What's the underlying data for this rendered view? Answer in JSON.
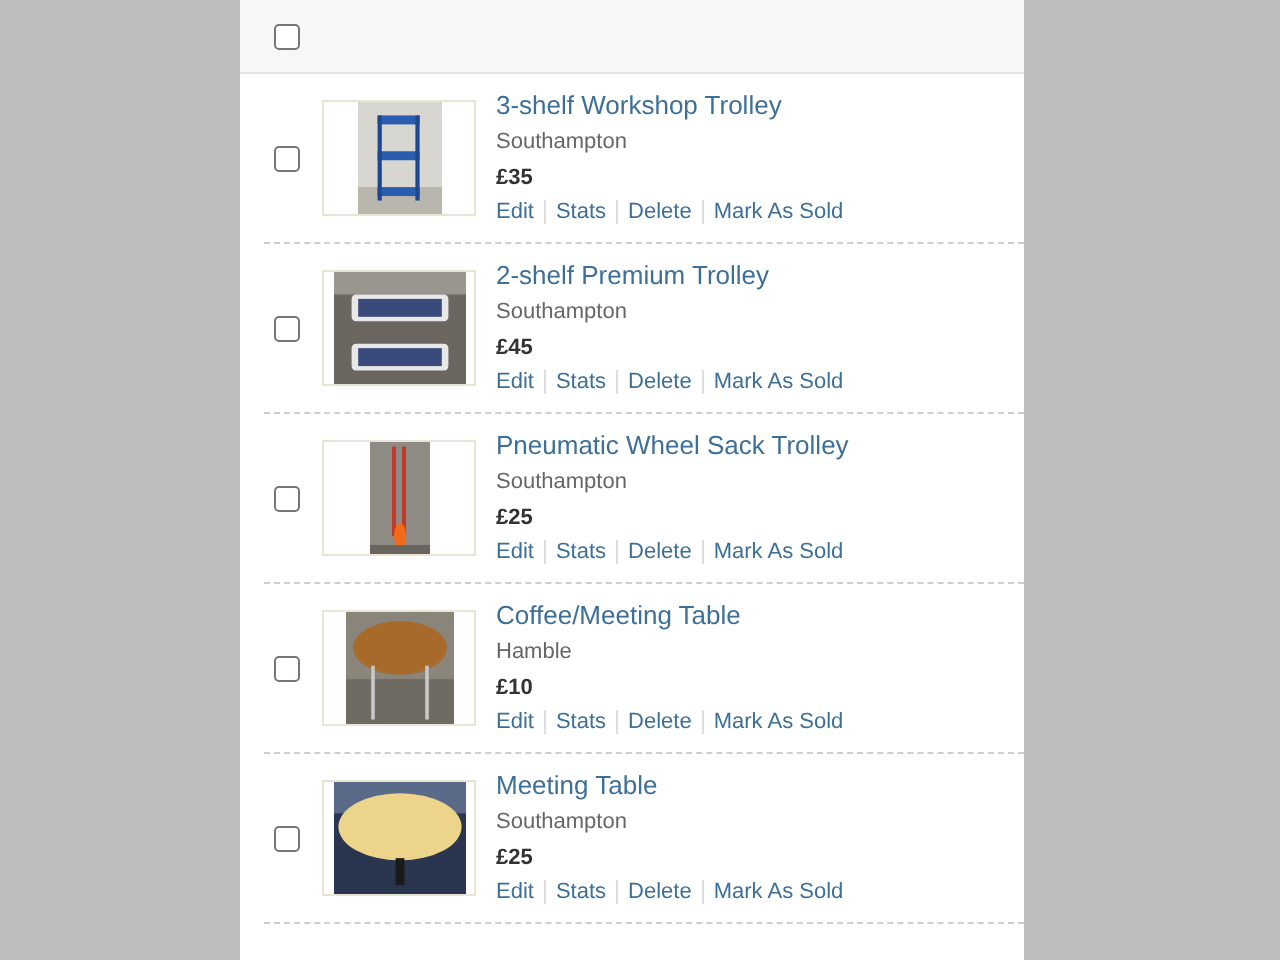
{
  "header": {
    "select_all": {
      "checked": false
    }
  },
  "listings": [
    {
      "title": "3-shelf Workshop Trolley",
      "location": "Southampton",
      "price": "£35",
      "checked": false,
      "photo": {
        "kind": "picture"
      },
      "actions": [
        "Edit",
        "Stats",
        "Delete",
        "Mark As Sold"
      ]
    },
    {
      "title": "2-shelf Premium Trolley",
      "location": "Southampton",
      "price": "£45",
      "checked": false,
      "photo": {
        "kind": "picture"
      },
      "actions": [
        "Edit",
        "Stats",
        "Delete",
        "Mark As Sold"
      ]
    },
    {
      "title": "Pneumatic Wheel Sack Trolley",
      "location": "Southampton",
      "price": "£25",
      "checked": false,
      "photo": {
        "kind": "picture"
      },
      "actions": [
        "Edit",
        "Stats",
        "Delete",
        "Mark As Sold"
      ]
    },
    {
      "title": "Coffee/Meeting Table",
      "location": "Hamble",
      "price": "£10",
      "checked": false,
      "photo": {
        "kind": "picture"
      },
      "actions": [
        "Edit",
        "Stats",
        "Delete",
        "Mark As Sold"
      ]
    },
    {
      "title": "Meeting Table",
      "location": "Southampton",
      "price": "£25",
      "checked": false,
      "photo": {
        "kind": "picture"
      },
      "actions": [
        "Edit",
        "Stats",
        "Delete",
        "Mark As Sold"
      ]
    }
  ]
}
